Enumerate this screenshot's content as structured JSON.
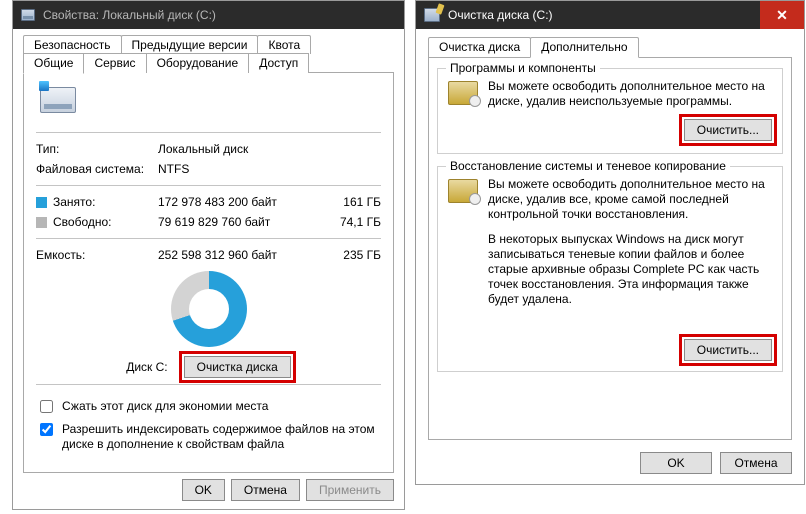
{
  "props": {
    "title": "Свойства: Локальный диск (C:)",
    "tabs_row1": [
      "Безопасность",
      "Предыдущие версии",
      "Квота"
    ],
    "tabs_row2": [
      "Общие",
      "Сервис",
      "Оборудование",
      "Доступ"
    ],
    "active_tab": "Общие",
    "type_label": "Тип:",
    "type_value": "Локальный диск",
    "fs_label": "Файловая система:",
    "fs_value": "NTFS",
    "used_label": "Занято:",
    "used_bytes": "172 978 483 200 байт",
    "used_gb": "161 ГБ",
    "free_label": "Свободно:",
    "free_bytes": "79 619 829 760 байт",
    "free_gb": "74,1 ГБ",
    "capacity_label": "Емкость:",
    "capacity_bytes": "252 598 312 960 байт",
    "capacity_gb": "235 ГБ",
    "disk_caption": "Диск C:",
    "cleanup_btn": "Очистка диска",
    "chk_compress": "Сжать этот диск для экономии места",
    "chk_index": "Разрешить индексировать содержимое файлов на этом диске в дополнение к свойствам файла",
    "ok": "OK",
    "cancel": "Отмена",
    "apply": "Применить"
  },
  "clean": {
    "title": "Очистка диска  (C:)",
    "tabs": [
      "Очистка диска",
      "Дополнительно"
    ],
    "active_tab": "Дополнительно",
    "group1": {
      "legend": "Программы и компоненты",
      "text": "Вы можете освободить дополнительное место на диске, удалив неиспользуемые программы.",
      "btn": "Очистить..."
    },
    "group2": {
      "legend": "Восстановление системы и теневое копирование",
      "text1": "Вы можете освободить дополнительное место на диске, удалив все, кроме самой последней контрольной точки восстановления.",
      "text2": "В некоторых выпусках Windows на диск могут записываться теневые копии файлов и более старые архивные образы Complete PC как часть точек восстановления. Эта информация также будет удалена.",
      "btn": "Очистить..."
    },
    "ok": "OK",
    "cancel": "Отмена"
  },
  "chart_data": {
    "type": "pie",
    "title": "Диск C:",
    "series": [
      {
        "name": "Занято",
        "value_bytes": 172978483200,
        "value_gb": 161,
        "color": "#26a0da"
      },
      {
        "name": "Свободно",
        "value_bytes": 79619829760,
        "value_gb": 74.1,
        "color": "#b6b6b6"
      }
    ],
    "total_bytes": 252598312960,
    "total_gb": 235
  }
}
